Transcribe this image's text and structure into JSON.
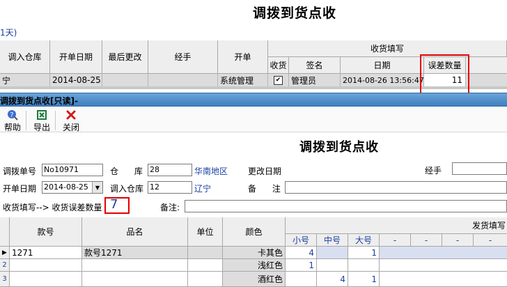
{
  "top_title": "调拨到货点收",
  "days_fragment": "1天)",
  "grid1": {
    "headers": {
      "warehouse_in": "调入仓库",
      "open_date": "开单日期",
      "last_changed": "最后更改",
      "handler": "经手",
      "opener": "开单",
      "receive_fill": "收货填写",
      "received": "收货",
      "sign": "签名",
      "date": "日期",
      "error_qty": "误差数量"
    },
    "row": {
      "warehouse_fragment": "宁",
      "open_date": "2014-08-25",
      "last_changed": "",
      "handler": "",
      "opener": "系统管理",
      "received_checked": "✔",
      "sign": "管理员",
      "date": "2014-08-26 13:56:47",
      "error_qty": "11"
    }
  },
  "window_title": "调拨到货点收[只读]-",
  "toolbar": {
    "help": "帮助",
    "export": "导出",
    "close": "关闭"
  },
  "form": {
    "title": "调拨到货点收",
    "transfer_no_label": "调拨单号",
    "transfer_no": "No10971",
    "warehouse_label": "仓      库",
    "warehouse_code": "28",
    "warehouse_name": "华南地区",
    "change_date_label": "更改日期",
    "handler_label": "经手",
    "open_date_label": "开单日期",
    "open_date": "2014-08-25",
    "in_warehouse_label": "调入仓库",
    "in_warehouse_code": "12",
    "in_warehouse_name": "辽宁",
    "remark_label": "备      注",
    "receive_error_label": "收货填写--> 收货误差数量",
    "receive_error_value": "7",
    "remark2_label": "备注:"
  },
  "grid2": {
    "headers": {
      "style_no": "款号",
      "product_name": "品名",
      "unit": "单位",
      "color": "颜色",
      "ship_fill": "发货填写",
      "sizes": [
        "小号",
        "中号",
        "大号",
        "-",
        "-",
        "-",
        "-"
      ]
    },
    "rows": [
      {
        "num": "1",
        "style_no": "1271",
        "product_name": "款号1271",
        "color": "卡其色",
        "small": "4",
        "medium": "",
        "large": "1"
      },
      {
        "num": "2",
        "style_no": "",
        "product_name": "",
        "color": "浅红色",
        "small": "1",
        "medium": "",
        "large": ""
      },
      {
        "num": "3",
        "style_no": "",
        "product_name": "",
        "color": "酒红色",
        "small": "",
        "medium": "4",
        "large": "1"
      }
    ]
  },
  "colors": {
    "accent_red": "#e30000",
    "title_bar": "#4a8ccc",
    "link_blue": "#1a3fa0"
  }
}
